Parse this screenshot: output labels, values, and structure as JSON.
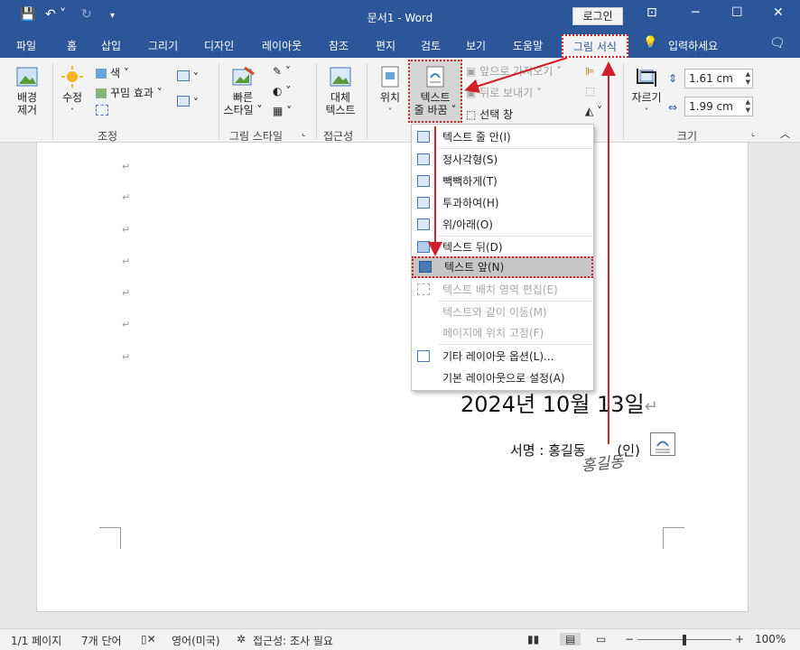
{
  "titlebar": {
    "title": "문서1 - Word",
    "login": "로그인",
    "qa_save": "💾",
    "qa_undo": "↶ ˅",
    "qa_redo": "↻",
    "qa_more": "‹",
    "restore": "⊡",
    "minimize": "─",
    "maximize": "☐",
    "close": "✕"
  },
  "tabs": [
    "파일",
    "홈",
    "삽입",
    "그리기",
    "디자인",
    "레이아웃",
    "참조",
    "편지",
    "검토",
    "보기",
    "도움말"
  ],
  "active_tab": "그림 서식",
  "tell_me": "입력하세요",
  "ribbon": {
    "remove_bg": [
      "배경",
      "제거"
    ],
    "corrections": "수정",
    "color": "색 ˅",
    "artistic": "꾸밈 효과 ˅",
    "adjust_group": "조정",
    "quick_styles": [
      "빠른",
      "스타일 ˅"
    ],
    "pic_styles_group": "그림 스타일",
    "alt_text": [
      "대체",
      "텍스트"
    ],
    "access_group": "접근성",
    "position": "위치",
    "wrap_text": [
      "텍스트",
      "줄 바꿈 ˅"
    ],
    "bring_forward": "앞으로 가져오기 ˅",
    "send_backward": "뒤로 보내기 ˅",
    "selection_pane": "선택 창",
    "crop": "자르기",
    "height": "1.61 cm",
    "width": "1.99 cm",
    "size_group": "크기"
  },
  "menu": {
    "items": [
      {
        "label": "텍스트 줄 안(I)",
        "enabled": true
      },
      {
        "label": "정사각형(S)",
        "enabled": true
      },
      {
        "label": "빽빽하게(T)",
        "enabled": true
      },
      {
        "label": "투과하여(H)",
        "enabled": true
      },
      {
        "label": "위/아래(O)",
        "enabled": true
      },
      {
        "label": "텍스트 뒤(D)",
        "enabled": true
      },
      {
        "label": "텍스트 앞(N)",
        "enabled": true,
        "highlighted": true
      },
      {
        "label": "텍스트 배치 영역 편집(E)",
        "enabled": false
      },
      {
        "label": "텍스트와 같이 이동(M)",
        "enabled": false
      },
      {
        "label": "페이지에 위치 고정(F)",
        "enabled": false
      },
      {
        "label": "기타 레이아웃 옵션(L)...",
        "enabled": true
      },
      {
        "label": "기본 레이아웃으로 설정(A)",
        "enabled": true
      }
    ]
  },
  "document": {
    "para_mark": "↵",
    "date": "2024년  10월  13일",
    "signature_label": "서명 : 홍길동",
    "seal": "(인)",
    "handwriting": "홍길동"
  },
  "status": {
    "page": "1/1 페이지",
    "words": "7개 단어",
    "language": "영어(미국)",
    "accessibility": "접근성: 조사 필요",
    "zoom": "100%"
  },
  "colors": {
    "brand": "#2b579a",
    "annotation": "#d0202a"
  }
}
